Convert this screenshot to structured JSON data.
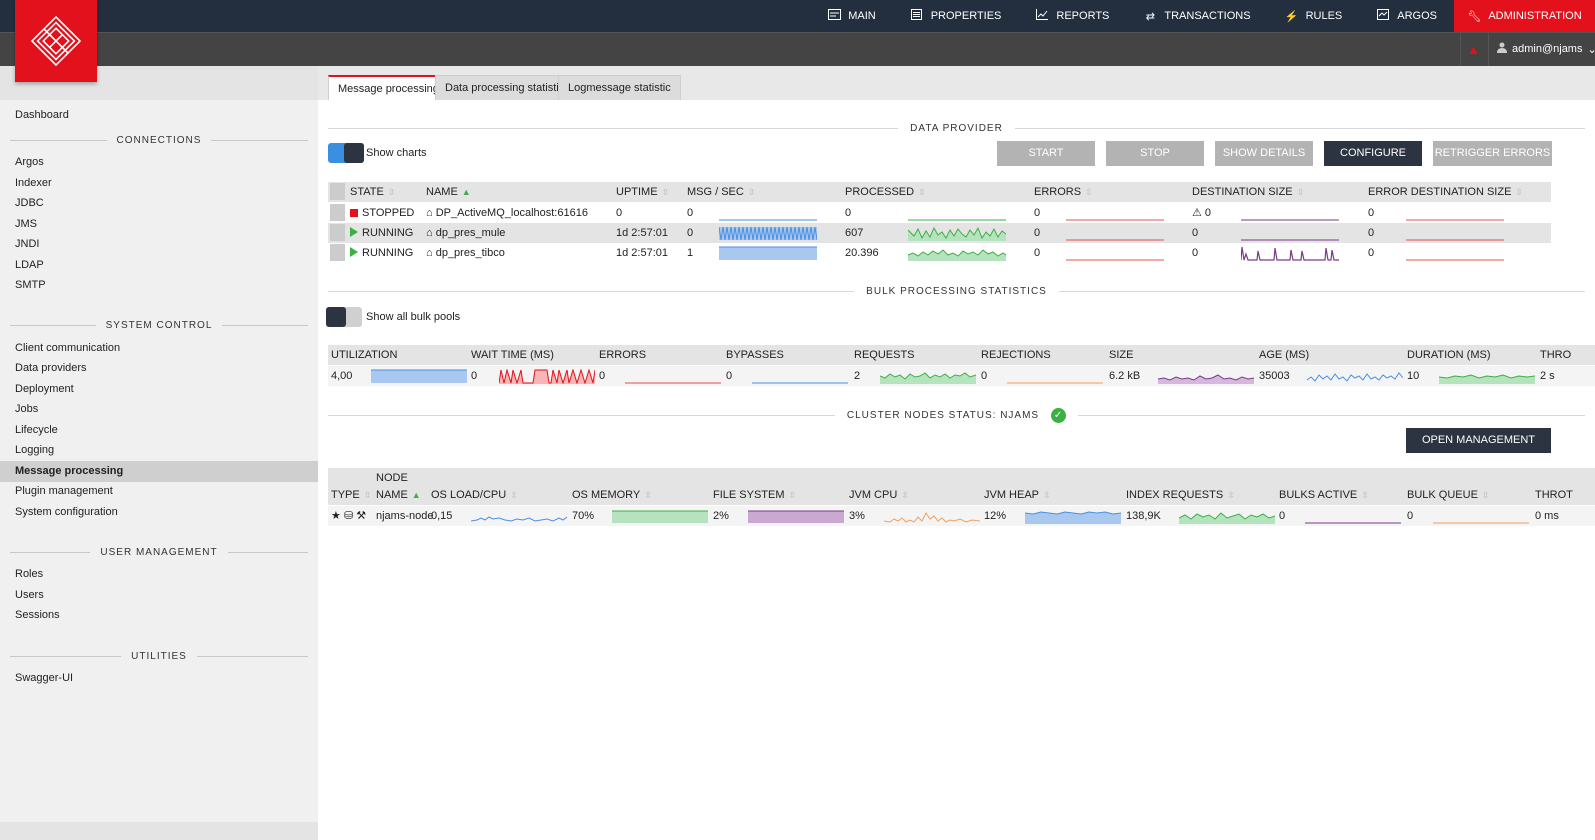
{
  "nav": {
    "items": [
      {
        "label": "MAIN",
        "icon": "main-icon"
      },
      {
        "label": "PROPERTIES",
        "icon": "properties-icon"
      },
      {
        "label": "REPORTS",
        "icon": "reports-icon"
      },
      {
        "label": "TRANSACTIONS",
        "icon": "transactions-icon"
      },
      {
        "label": "RULES",
        "icon": "rules-icon"
      },
      {
        "label": "ARGOS",
        "icon": "argos-icon"
      },
      {
        "label": "ADMINISTRATION",
        "icon": "wrench-icon"
      }
    ],
    "user": "admin@njams"
  },
  "colors": {
    "brand": "#e2111c",
    "navbar": "#232f3e",
    "subbar": "#444444",
    "accent_green": "#3cb043",
    "button_dark": "#2b3440",
    "button_disabled": "#b3b3b3"
  },
  "sidebar": {
    "dashboard": "Dashboard",
    "connections": {
      "title": "CONNECTIONS",
      "items": [
        "Argos",
        "Indexer",
        "JDBC",
        "JMS",
        "JNDI",
        "LDAP",
        "SMTP"
      ]
    },
    "system_control": {
      "title": "SYSTEM CONTROL",
      "items": [
        "Client communication",
        "Data providers",
        "Deployment",
        "Jobs",
        "Lifecycle",
        "Logging",
        "Message processing",
        "Plugin management",
        "System configuration"
      ]
    },
    "user_management": {
      "title": "USER MANAGEMENT",
      "items": [
        "Roles",
        "Users",
        "Sessions"
      ]
    },
    "utilities": {
      "title": "UTILITIES",
      "items": [
        "Swagger-UI"
      ]
    }
  },
  "tabs": [
    "Message processing",
    "Data processing statistic",
    "Logmessage statistic"
  ],
  "data_provider": {
    "title": "DATA PROVIDER",
    "show_charts": "Show charts",
    "buttons": [
      "START",
      "STOP",
      "SHOW DETAILS",
      "CONFIGURE",
      "RETRIGGER ERRORS"
    ],
    "columns": [
      "STATE",
      "NAME",
      "UPTIME",
      "MSG / SEC",
      "PROCESSED",
      "ERRORS",
      "DESTINATION SIZE",
      "ERROR DESTINATION SIZE"
    ],
    "rows": [
      {
        "state": "STOPPED",
        "name": "DP_ActiveMQ_localhost:61616",
        "uptime": "0",
        "msg_sec": "0",
        "processed": "0",
        "errors": "0",
        "dest_size": "0",
        "err_dest_size": "0"
      },
      {
        "state": "RUNNING",
        "name": "dp_pres_mule",
        "uptime": "1d 2:57:01",
        "msg_sec": "0",
        "processed": "607",
        "errors": "0",
        "dest_size": "0",
        "err_dest_size": "0"
      },
      {
        "state": "RUNNING",
        "name": "dp_pres_tibco",
        "uptime": "1d 2:57:01",
        "msg_sec": "1",
        "processed": "20.396",
        "errors": "0",
        "dest_size": "0",
        "err_dest_size": "0"
      }
    ]
  },
  "bulk": {
    "title": "BULK PROCESSING STATISTICS",
    "show_all": "Show all bulk pools",
    "columns": [
      "UTILIZATION",
      "WAIT TIME (MS)",
      "ERRORS",
      "BYPASSES",
      "REQUESTS",
      "REJECTIONS",
      "SIZE",
      "AGE (MS)",
      "DURATION (MS)",
      "THRO"
    ],
    "values": [
      "4,00",
      "0",
      "0",
      "0",
      "2",
      "0",
      "6.2 kB",
      "35003",
      "10",
      "2 s"
    ]
  },
  "cluster": {
    "title": "CLUSTER NODES STATUS: NJAMS",
    "open_tool": "OPEN MANAGEMENT TOOL",
    "node_header": "NODE",
    "columns": [
      "TYPE",
      "NAME",
      "OS LOAD/CPU",
      "OS MEMORY",
      "FILE SYSTEM",
      "JVM CPU",
      "JVM HEAP",
      "INDEX REQUESTS",
      "BULKS ACTIVE",
      "BULK QUEUE",
      "THROT"
    ],
    "row": {
      "name": "njams-node",
      "os_load": "0,15",
      "os_memory": "70%",
      "file_system": "2%",
      "jvm_cpu": "3%",
      "jvm_heap": "12%",
      "index_requests": "138,9K",
      "bulks_active": "0",
      "bulk_queue": "0",
      "throt": "0 ms"
    }
  }
}
